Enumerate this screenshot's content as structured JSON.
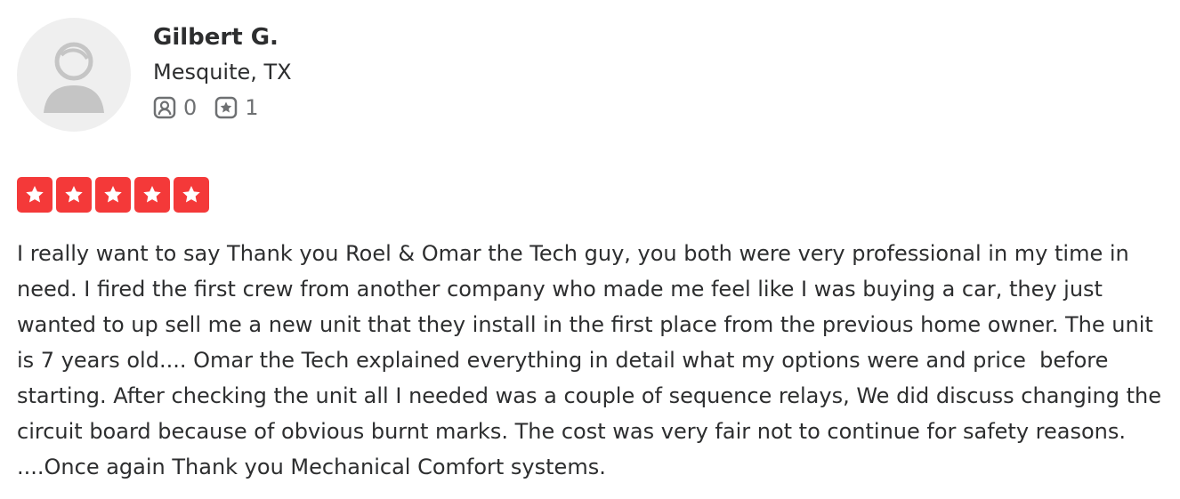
{
  "user": {
    "name": "Gilbert G.",
    "location": "Mesquite, TX",
    "friends_count": "0",
    "reviews_count": "1",
    "avatar_icon": "default-user-avatar-icon",
    "friends_icon": "friends-icon",
    "reviews_icon": "review-star-icon"
  },
  "rating": {
    "stars": 5,
    "max": 5,
    "color": "#f43939"
  },
  "review": {
    "text": "I really want to say Thank you Roel & Omar the Tech guy, you both were very professional in my time in need. I fired the first crew from another company who made me feel like I was buying a car, they just wanted to up sell me a new unit that they install in the first place from the previous home owner. The unit is 7 years old.... Omar the Tech explained everything in detail what my options were and price  before starting. After checking the unit all I needed was a couple of sequence relays, We did discuss changing the circuit board because of obvious burnt marks. The cost was very fair not to continue for safety reasons. ....Once again Thank you Mechanical Comfort systems."
  }
}
